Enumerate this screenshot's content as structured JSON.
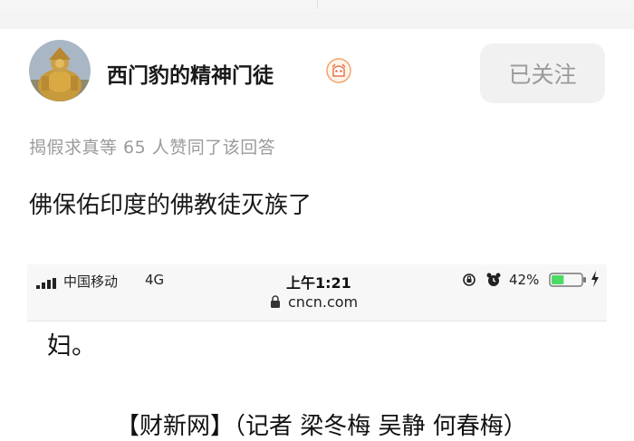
{
  "answer_author": {
    "name": "西门豹的精神门徒",
    "follow_label": "已关注"
  },
  "likes_text": "揭假求真等 65 人赞同了该回答",
  "answer_text": "佛保佑印度的佛教徒灭族了",
  "embedded_screenshot": {
    "status_bar": {
      "carrier": "中国移动",
      "network": "4G",
      "time": "上午1:21",
      "battery_percent": "42%",
      "battery_level": 0.42
    },
    "url": "cncn.com",
    "article_line1": "妇。",
    "article_line2": "【财新网】（记者 梁冬梅 吴静 何春梅）"
  },
  "colors": {
    "follow_bg": "#f1f1f1",
    "follow_text": "#9a9a9a",
    "muted_text": "#9b9b9b",
    "battery_green": "#4cd964"
  }
}
